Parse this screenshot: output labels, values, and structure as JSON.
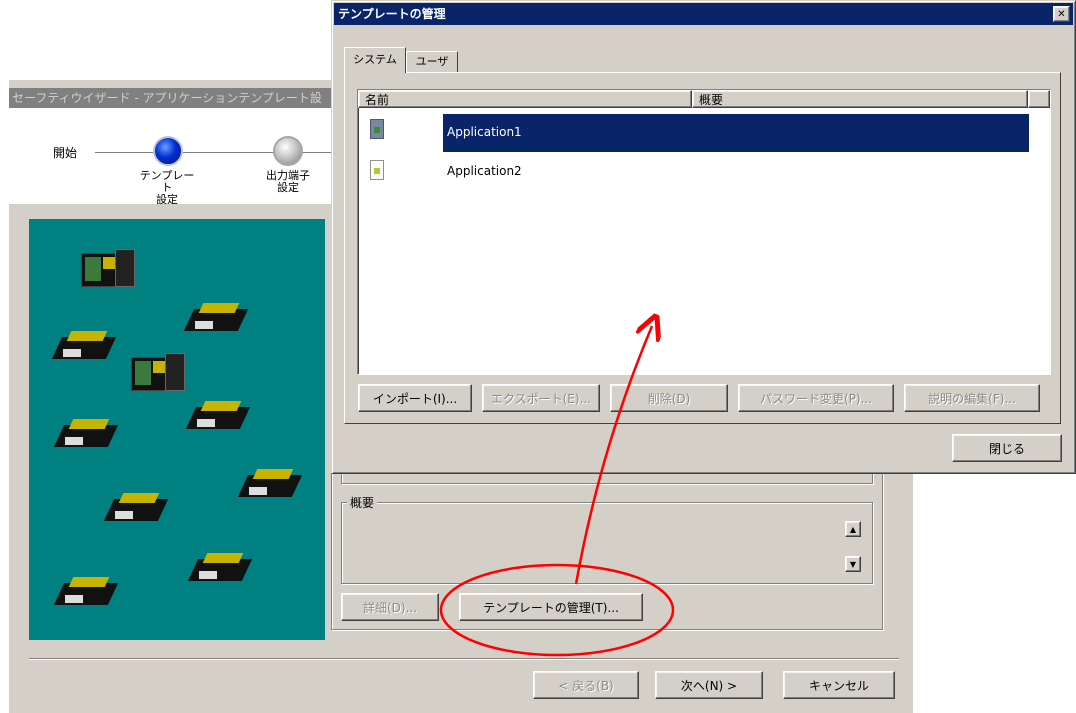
{
  "wizard": {
    "title": "セーフティウイザード - アプリケーションテンプレート設",
    "steps": [
      {
        "label": "開始"
      },
      {
        "label": "テンプレート\n設定"
      },
      {
        "label": "出力端子\n設定"
      }
    ],
    "summary_label": "概要",
    "details_button": "詳細(D)...",
    "manage_button": "テンプレートの管理(T)...",
    "back_button": "< 戻る(B)",
    "next_button": "次へ(N) >",
    "cancel_button": "キャンセル"
  },
  "dialog": {
    "title": "テンプレートの管理",
    "close_x": "✕",
    "tabs": [
      {
        "label": "システム",
        "active": true
      },
      {
        "label": "ユーザ",
        "active": false
      }
    ],
    "columns": [
      "名前",
      "概要"
    ],
    "items": [
      {
        "name": "Application1",
        "selected": true
      },
      {
        "name": "Application2",
        "selected": false
      }
    ],
    "buttons": {
      "import": "インポート(I)...",
      "export": "エクスポート(E)...",
      "delete": "削除(D)",
      "password": "パスワード変更(P)...",
      "edit_desc": "説明の編集(F)..."
    },
    "close_button": "閉じる"
  },
  "colors": {
    "titlebar": "#0a246a",
    "selection": "#0a246a",
    "canvas": "#008080",
    "annotation": "#ff0000"
  }
}
